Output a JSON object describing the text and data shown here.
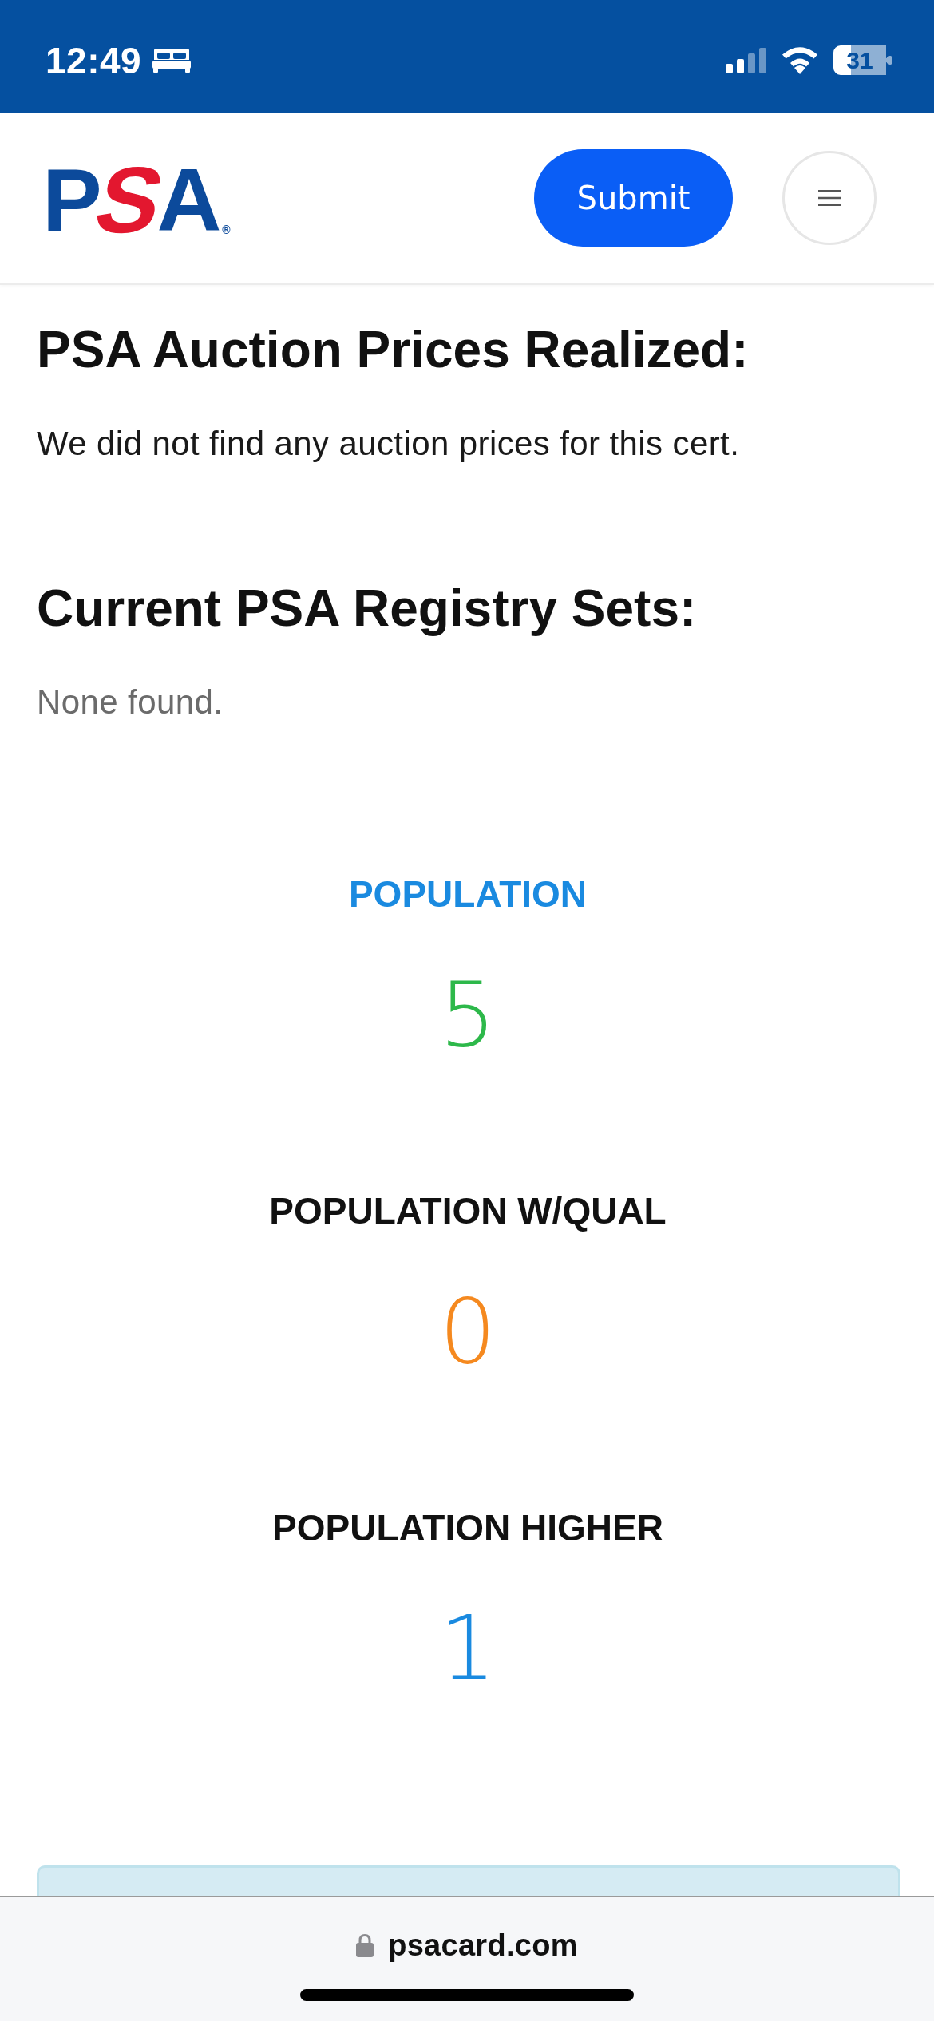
{
  "status_bar": {
    "time": "12:49",
    "battery": "31"
  },
  "header": {
    "logo": "PSA",
    "logo_mark": "®",
    "submit_button": "Submit"
  },
  "sections": [
    {
      "title": "PSA Auction Prices Realized:",
      "text": "We did not find any auction prices for this cert.",
      "kind": "message"
    },
    {
      "title": "Current PSA Registry Sets:",
      "text": "None found.",
      "kind": "empty"
    }
  ],
  "population": [
    {
      "label": "POPULATION",
      "highlighted": true,
      "value": "5",
      "color": "#2db84a"
    },
    {
      "label": "POPULATION W/QUAL",
      "highlighted": false,
      "value": "0",
      "color": "#f5891f"
    },
    {
      "label": "POPULATION HIGHER",
      "highlighted": false,
      "value": "1",
      "color": "#1a8ae0"
    }
  ],
  "browser_bar": {
    "url": "psacard.com"
  }
}
